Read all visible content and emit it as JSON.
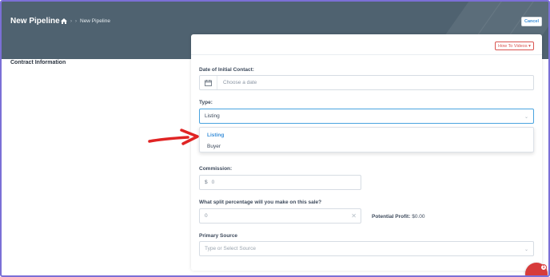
{
  "header": {
    "title": "New Pipeline",
    "breadcrumb_current": "New Pipeline",
    "breadcrumb_sep": "›",
    "cancel_label": "Cancel"
  },
  "sidebar": {
    "section_label": "Contract Information"
  },
  "form": {
    "howto_label": "How To Videos ▾",
    "date_label": "Date of Initial Contact:",
    "date_placeholder": "Choose a date",
    "type_label": "Type:",
    "type_value": "Listing",
    "type_options": [
      "Listing",
      "Buyer"
    ],
    "commission_label": "Commission:",
    "commission_prefix": "$",
    "commission_value": "0",
    "split_label": "What split percentage will you make on this sale?",
    "split_value": "0",
    "profit_label": "Potential Profit:",
    "profit_value": "$0.00",
    "source_label": "Primary Source",
    "source_placeholder": "Type or Select Source"
  },
  "chat": {
    "badge": "1"
  },
  "colors": {
    "header_bg": "#4f6270",
    "accent": "#3a8fd9",
    "danger": "#d9534f",
    "arrow": "#e02424",
    "frame": "#7b6fd6"
  },
  "icons": [
    "home-icon",
    "calendar-icon",
    "chevron-down-icon",
    "clear-icon",
    "chat-icon"
  ]
}
